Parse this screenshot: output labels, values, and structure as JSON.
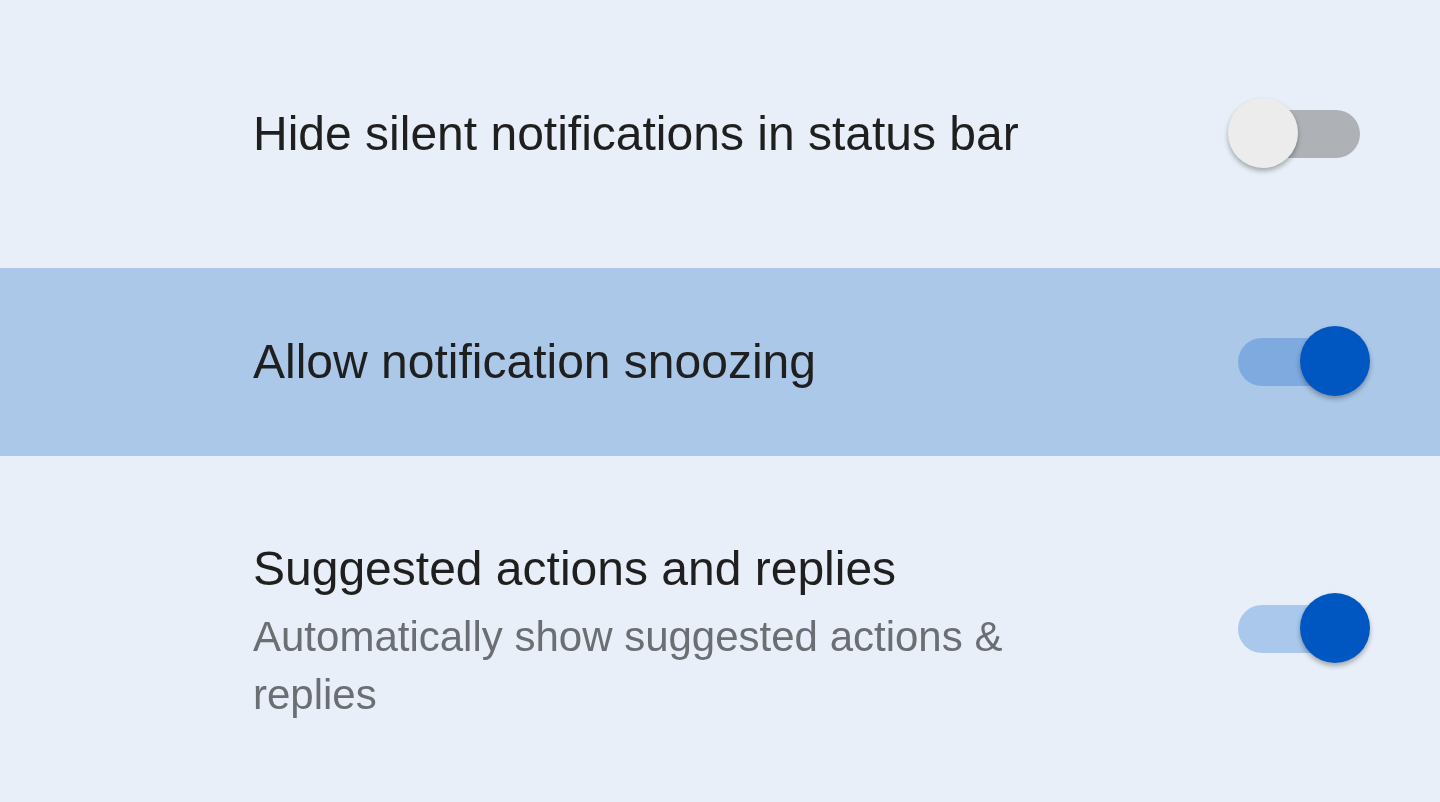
{
  "settings": [
    {
      "title": "Hide silent notifications in status bar",
      "on": false,
      "highlighted": false
    },
    {
      "title": "Allow notification snoozing",
      "on": true,
      "highlighted": true
    },
    {
      "title": "Suggested actions and replies",
      "subtitle": "Automatically show suggested actions & replies",
      "on": true,
      "highlighted": false
    }
  ]
}
